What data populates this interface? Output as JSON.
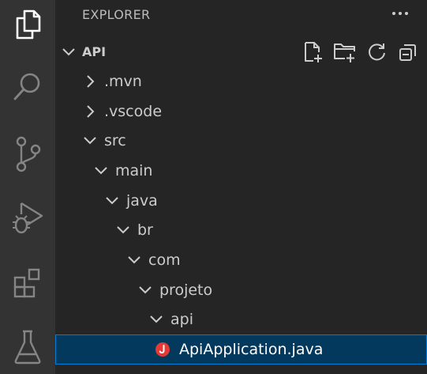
{
  "activity_bar": {
    "icons": [
      "files-icon",
      "search-icon",
      "source-control-icon",
      "run-debug-icon",
      "extensions-icon",
      "testing-icon"
    ]
  },
  "explorer": {
    "title": "EXPLORER",
    "more_actions": "···",
    "section": {
      "title": "API",
      "actions": [
        "new-file-icon",
        "new-folder-icon",
        "refresh-icon",
        "collapse-all-icon"
      ]
    },
    "tree": [
      {
        "label": ".mvn",
        "expanded": false,
        "depth": 1
      },
      {
        "label": ".vscode",
        "expanded": false,
        "depth": 1
      },
      {
        "label": "src",
        "expanded": true,
        "depth": 1
      },
      {
        "label": "main",
        "expanded": true,
        "depth": 2
      },
      {
        "label": "java",
        "expanded": true,
        "depth": 3
      },
      {
        "label": "br",
        "expanded": true,
        "depth": 4
      },
      {
        "label": "com",
        "expanded": true,
        "depth": 5
      },
      {
        "label": "projeto",
        "expanded": true,
        "depth": 6
      },
      {
        "label": "api",
        "expanded": true,
        "depth": 7
      },
      {
        "label": "ApiApplication.java",
        "file": true,
        "selected": true,
        "depth": 8
      }
    ]
  },
  "colors": {
    "activity_bar": "#333333",
    "sidebar": "#252526",
    "selection": "#04395e",
    "selection_border": "#007fd4",
    "java_icon": "#e53935"
  }
}
